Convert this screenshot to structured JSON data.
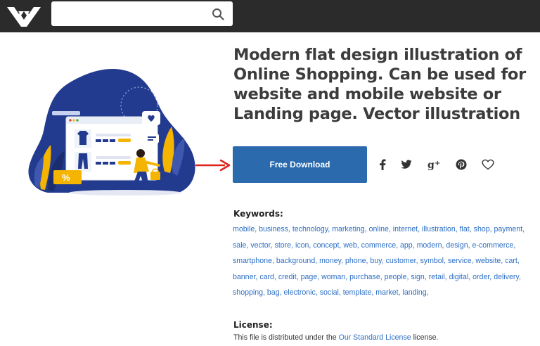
{
  "header": {
    "logo_label": "Vecteezy logo",
    "search": {
      "value": "",
      "placeholder": ""
    }
  },
  "illustration": {
    "badge_text": "%"
  },
  "product": {
    "title_lines": [
      "Modern flat design illustration of",
      "Online Shopping. Can be used for",
      "website and mobile website or",
      "Landing page. Vector illustration"
    ],
    "download_label": "Free Download",
    "share_icons": [
      "facebook-icon",
      "twitter-icon",
      "google-plus-icon",
      "pinterest-icon",
      "heart-icon"
    ]
  },
  "keywords": {
    "heading": "Keywords:",
    "items": [
      "mobile",
      "business",
      "technology",
      "marketing",
      "online",
      "internet",
      "illustration",
      "flat",
      "shop",
      "payment",
      "sale",
      "vector",
      "store",
      "icon",
      "concept",
      "web",
      "commerce",
      "app",
      "modern",
      "design",
      "e-commerce",
      "smartphone",
      "background",
      "money",
      "phone",
      "buy",
      "customer",
      "symbol",
      "service",
      "website",
      "cart",
      "banner",
      "card",
      "credit",
      "page",
      "woman",
      "purchase",
      "people",
      "sign",
      "retail",
      "digital",
      "order",
      "delivery",
      "shopping",
      "bag",
      "electronic",
      "social",
      "template",
      "market",
      "landing"
    ]
  },
  "license": {
    "heading": "License:",
    "text_before": "This file is distributed under the ",
    "link_text": "Our Standard License",
    "text_after": " license."
  },
  "colors": {
    "topbar": "#2b2b2b",
    "button": "#2a6aad",
    "link": "#2d6fc4",
    "arrow": "#e0221c",
    "illustration_blue": "#233b8f",
    "illustration_yellow": "#f4b400"
  }
}
